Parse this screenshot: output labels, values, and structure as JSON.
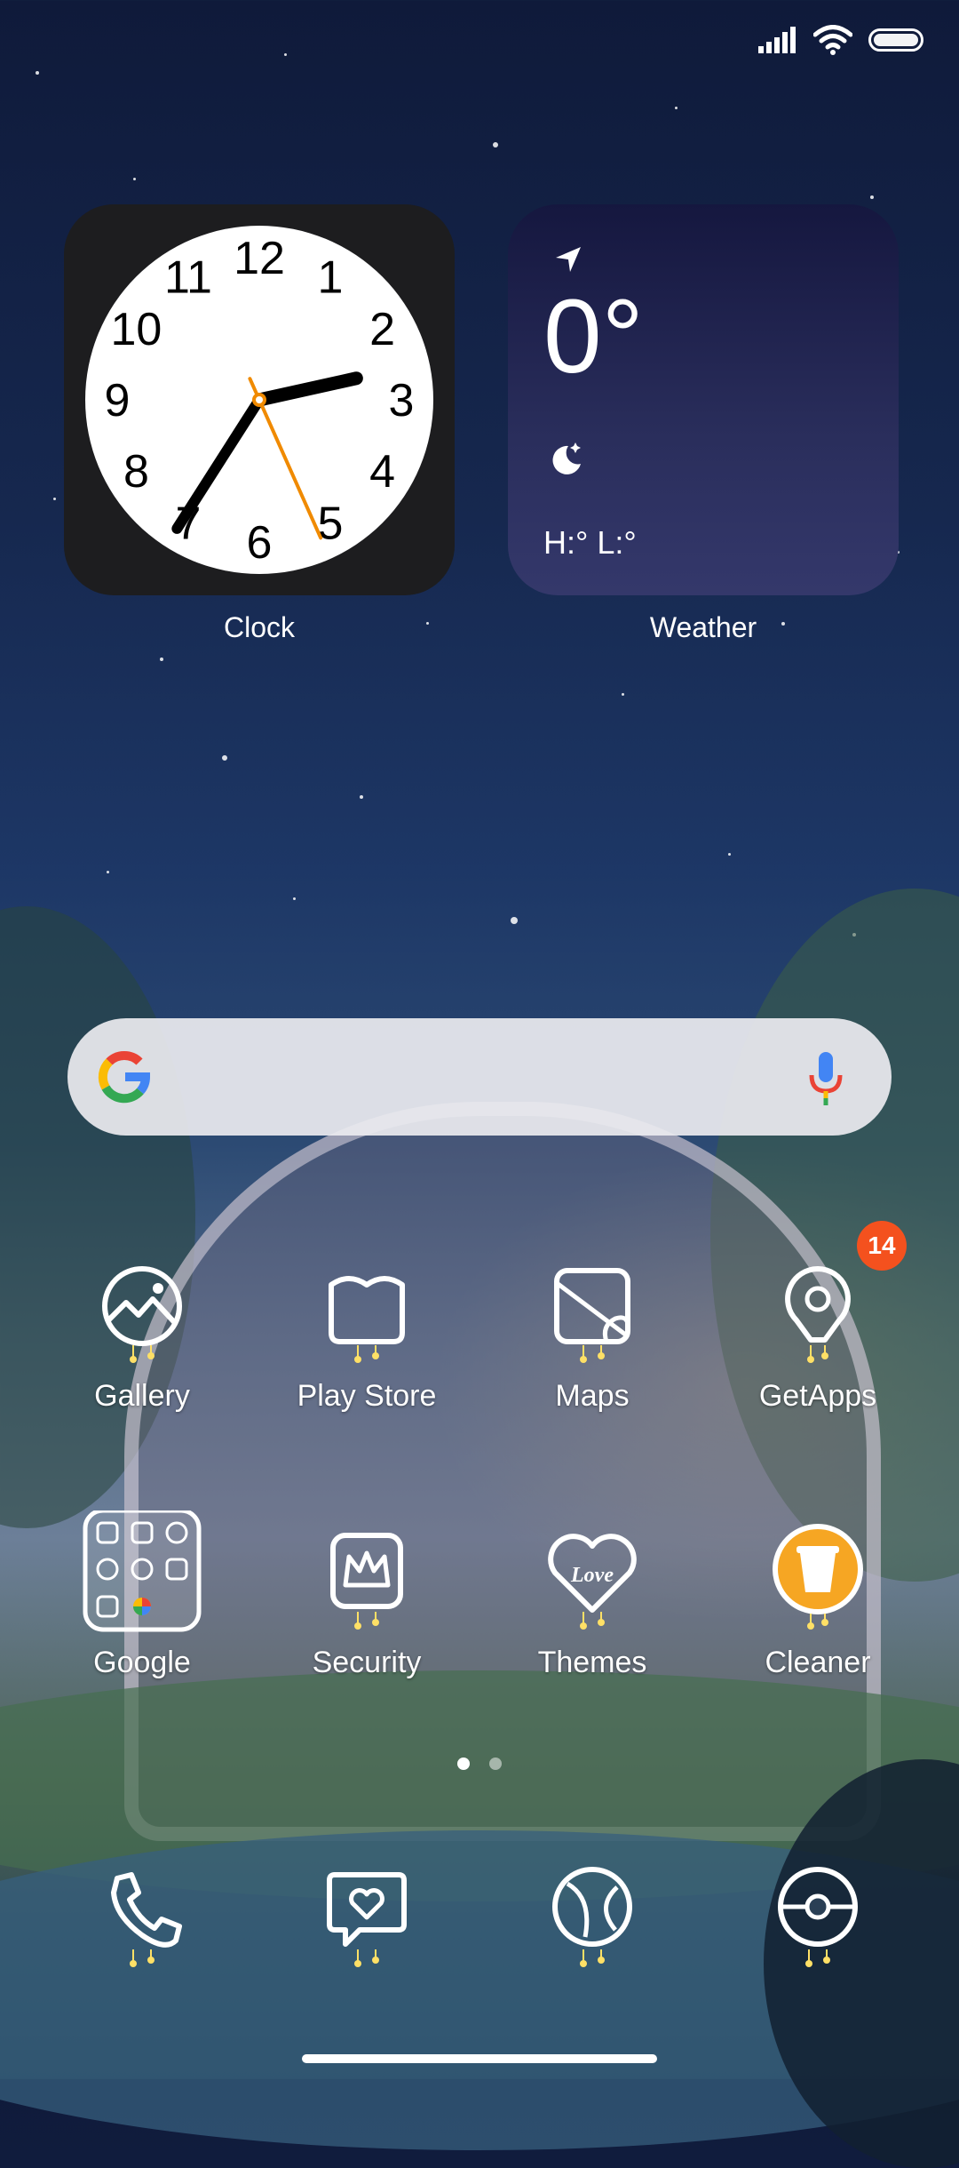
{
  "status_bar": {
    "signal_icon": "signal-icon",
    "wifi_icon": "wifi-icon",
    "battery_icon": "battery-icon"
  },
  "widgets": {
    "clock": {
      "label": "Clock",
      "numbers": [
        "12",
        "1",
        "2",
        "3",
        "4",
        "5",
        "6",
        "7",
        "8",
        "9",
        "10",
        "11"
      ],
      "time": {
        "hour": 2,
        "minute": 35,
        "second": 26
      }
    },
    "weather": {
      "label": "Weather",
      "temperature": "0°",
      "high_low": "H:° L:°",
      "location_icon": "location-arrow-icon",
      "condition_icon": "moon-stars-icon"
    }
  },
  "search": {
    "logo_icon": "google-g-icon",
    "mic_icon": "mic-icon"
  },
  "apps": [
    {
      "label": "Gallery",
      "icon": "gallery-icon"
    },
    {
      "label": "Play Store",
      "icon": "play-store-icon"
    },
    {
      "label": "Maps",
      "icon": "maps-icon"
    },
    {
      "label": "GetApps",
      "icon": "getapps-icon",
      "badge": "14"
    },
    {
      "label": "Google",
      "icon": "google-folder-icon"
    },
    {
      "label": "Security",
      "icon": "security-icon"
    },
    {
      "label": "Themes",
      "icon": "themes-icon",
      "icon_text": "Love"
    },
    {
      "label": "Cleaner",
      "icon": "cleaner-icon"
    }
  ],
  "page_indicator": {
    "pages": 2,
    "current": 1
  },
  "dock": [
    {
      "icon": "phone-icon"
    },
    {
      "icon": "messages-icon"
    },
    {
      "icon": "browser-icon"
    },
    {
      "icon": "camera-icon"
    }
  ],
  "colors": {
    "badge": "#f4511e",
    "clock_second_hand": "#f08a00",
    "cleaner": "#f6a623"
  }
}
